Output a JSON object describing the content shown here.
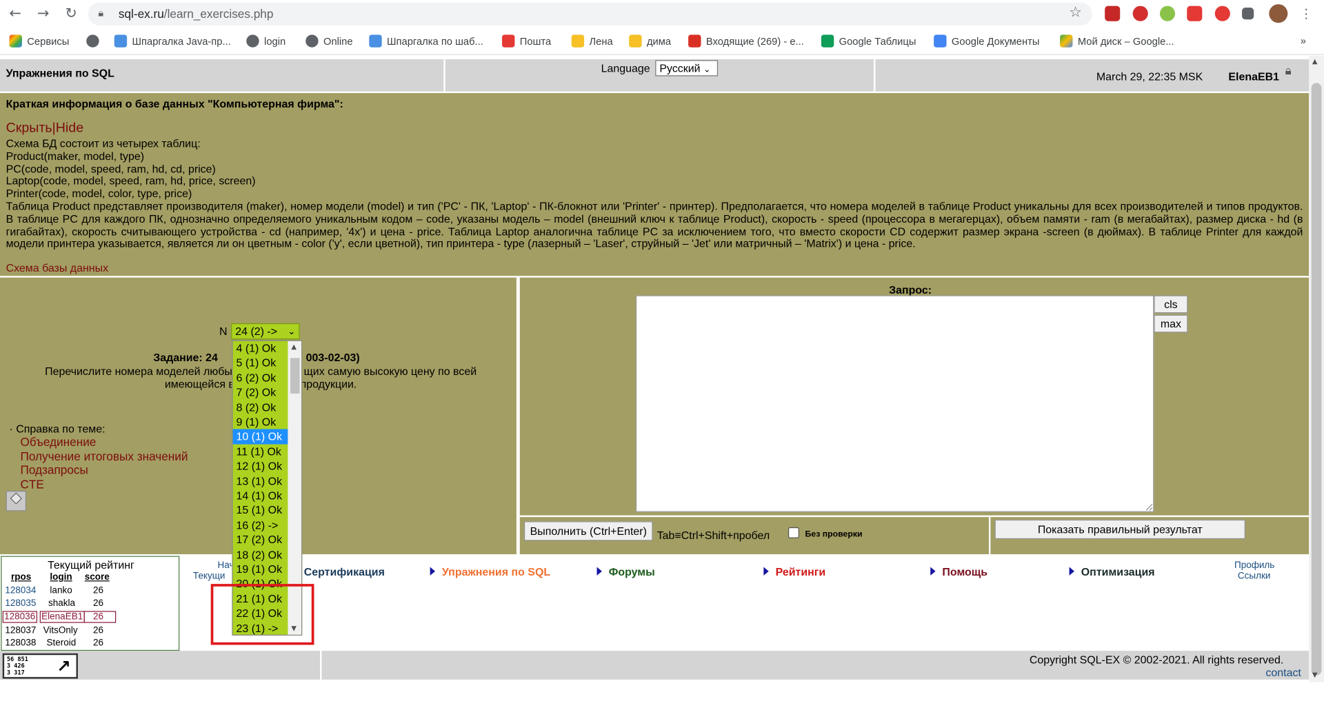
{
  "browser": {
    "url_host": "sql-ex.ru",
    "url_path": "/learn_exercises.php",
    "bookmarks": [
      {
        "label": "Сервисы",
        "icon": "apps-grid-icon",
        "color": "#ea4335"
      },
      {
        "label": "",
        "icon": "globe-icon",
        "color": "#5f6368"
      },
      {
        "label": "Шпаргалка Java-пр...",
        "icon": "sparkle-icon",
        "color": "#4a90e2"
      },
      {
        "label": "login",
        "icon": "globe-icon",
        "color": "#5f6368"
      },
      {
        "label": "Online",
        "icon": "globe-icon",
        "color": "#5f6368"
      },
      {
        "label": "Шпаргалка по шаб...",
        "icon": "sparkle-icon",
        "color": "#4a90e2"
      },
      {
        "label": "Пошта",
        "icon": "mail-icon",
        "color": "#e53935"
      },
      {
        "label": "Лена",
        "icon": "folder-icon",
        "color": "#f6c026"
      },
      {
        "label": "дима",
        "icon": "folder-icon",
        "color": "#f6c026"
      },
      {
        "label": "Входящие (269) - e...",
        "icon": "gmail-icon",
        "color": "#d93025"
      },
      {
        "label": "Google Таблицы",
        "icon": "sheets-icon",
        "color": "#0f9d58"
      },
      {
        "label": "Google Документы",
        "icon": "docs-icon",
        "color": "#4285f4"
      },
      {
        "label": "Мой диск – Google...",
        "icon": "drive-icon",
        "color": "#fbbc04"
      }
    ],
    "more_label": "»"
  },
  "header": {
    "title": "Упражнения по SQL",
    "language_label": "Language",
    "language_value": "Русский",
    "date": "March 29, 22:35 MSK",
    "user": "ElenaEB1"
  },
  "info": {
    "heading": "Краткая информация о базе данных \"Компьютерная фирма\":",
    "hide_link": "Скрыть|Hide",
    "lines": [
      "Схема БД состоит из четырех таблиц:",
      "Product(maker, model, type)",
      "PC(code, model, speed, ram, hd, cd, price)",
      "Laptop(code, model, speed, ram, hd, price, screen)",
      "Printer(code, model, color, type, price)",
      "Таблица Product представляет производителя (maker), номер модели (model) и тип ('PC' - ПК, 'Laptop' - ПК-блокнот или 'Printer' - принтер). Предполагается, что номера моделей в таблице Product уникальны для всех производителей и типов продуктов. В таблице PC для каждого ПК, однозначно определяемого уникальным кодом – code, указаны модель – model (внешний ключ к таблице Product), скорость - speed (процессора в мегагерцах), объем памяти - ram (в мегабайтах), размер диска - hd (в гигабайтах), скорость считывающего устройства - cd (например, '4x') и цена - price. Таблица Laptop аналогична таблице PC за исключением того, что вместо скорости CD содержит размер экрана -screen (в дюймах). В таблице Printer для каждой модели принтера указывается, является ли он цветным - color ('y', если цветной), тип принтера - type (лазерный – 'Laser', струйный – 'Jet' или матричный – 'Matrix') и цена - price."
    ],
    "schema_link": "Схема базы данных"
  },
  "task": {
    "n_label": "N",
    "selected": "24 (2) ->",
    "title_visible_left": "Задание: 24",
    "title_visible_right": "003-02-03)",
    "text_line1_left": "Перечислите номера моделей любых",
    "text_line1_right": "щих самую высокую цену по всей",
    "text_line2_left": "имеющейся в",
    "text_line2_right": "продукции.",
    "help_label": "· Справка по теме:",
    "help_links": [
      "Объединение",
      "Получение итоговых значений",
      "Подзапросы",
      "CTE"
    ]
  },
  "dropdown": {
    "items": [
      "4 (1) Ok",
      "5 (1) Ok",
      "6 (2) Ok",
      "7 (2) Ok",
      "8 (2) Ok",
      "9 (1) Ok",
      "10 (1) Ok",
      "11 (1) Ok",
      "12 (1) Ok",
      "13 (1) Ok",
      "14 (1) Ok",
      "15 (1) Ok",
      "16 (2) ->",
      "17 (2) Ok",
      "18 (2) Ok",
      "19 (1) Ok",
      "20 (1) Ok",
      "21 (1) Ok",
      "22 (1) Ok",
      "23 (1) ->"
    ],
    "highlighted": "10 (1) Ok"
  },
  "query": {
    "label": "Запрос:",
    "value": "",
    "cls_label": "cls",
    "max_label": "max",
    "run_label": "Выполнить (Ctrl+Enter)",
    "tab_hint": "Tab≡Ctrl+Shift+пробел",
    "noverify_label": "Без проверки",
    "show_result_label": "Показать правильный результат"
  },
  "rating": {
    "title": "Текущий рейтинг",
    "columns": [
      "rpos",
      "login",
      "score"
    ],
    "rows": [
      {
        "rpos": "128034",
        "login": "lanko",
        "score": "26"
      },
      {
        "rpos": "128035",
        "login": "shakla",
        "score": "26"
      },
      {
        "rpos": "128036",
        "login": "ElenaEB1",
        "score": "26"
      },
      {
        "rpos": "128037",
        "login": "VitsOnly",
        "score": "26"
      },
      {
        "rpos": "128038",
        "login": "Steroid",
        "score": "26"
      }
    ]
  },
  "menu": {
    "partial_left_top": "Нач",
    "partial_left_bottom": "Текущи",
    "items": [
      {
        "label": "Сертификация",
        "color": "#1a3a5a"
      },
      {
        "label": "Упражнения по SQL",
        "color": "#f07030"
      },
      {
        "label": "Форумы",
        "color": "#1a5a1a"
      },
      {
        "label": "Рейтинги",
        "color": "#d01818"
      },
      {
        "label": "Помощь",
        "color": "#7a1020"
      },
      {
        "label": "Оптимизация",
        "color": "#1a2a2a"
      }
    ],
    "profile_link": "Профиль",
    "links_link": "Ссылки"
  },
  "footer": {
    "counter_lines": [
      "56 851",
      "3 426",
      "3 317"
    ],
    "copyright": "Copyright SQL-EX © 2002-2021. All rights reserved.",
    "contact": "contact"
  }
}
